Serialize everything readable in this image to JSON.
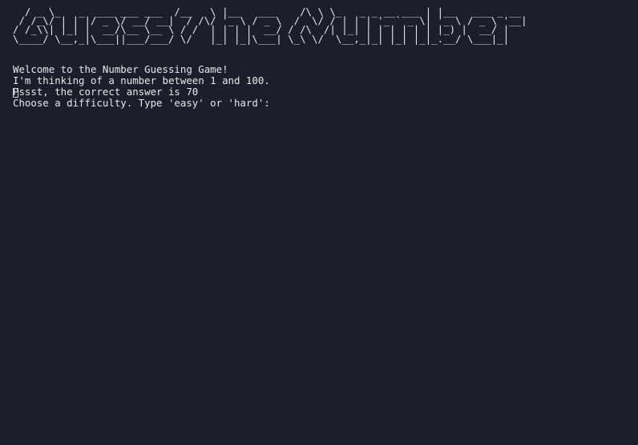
{
  "terminal": {
    "banner_lines": [
      "  / _ \\_   _  ___ ___ ___  /__   \\ |__   ___    /\\ \\ \\_   _ _ __ ___ | |__   ___ _ __",
      " / /_\\/ | | |/ _ \\/ __/ __|  / /\\/ '_ \\ / _ \\  /  \\/ / | | | '_ ` _ \\| '_ \\ / _ \\ '__|",
      "/ /_\\\\| |_| |  __/\\__ \\__ \\ / /  | | | |  __/ / /\\  /| |_| | | | | | | |_) |  __/ |",
      "\\____/ \\__,_|\\___||___/___/ \\/   |_| |_|\\___| \\_\\ \\/  \\__,_|_| |_| |_|_.__/ \\___|_|"
    ],
    "output_lines": [
      "Welcome to the Number Guessing Game!",
      "I'm thinking of a number between 1 and 100.",
      "Pssst, the correct answer is 70",
      "Choose a difficulty. Type 'easy' or 'hard':"
    ]
  }
}
